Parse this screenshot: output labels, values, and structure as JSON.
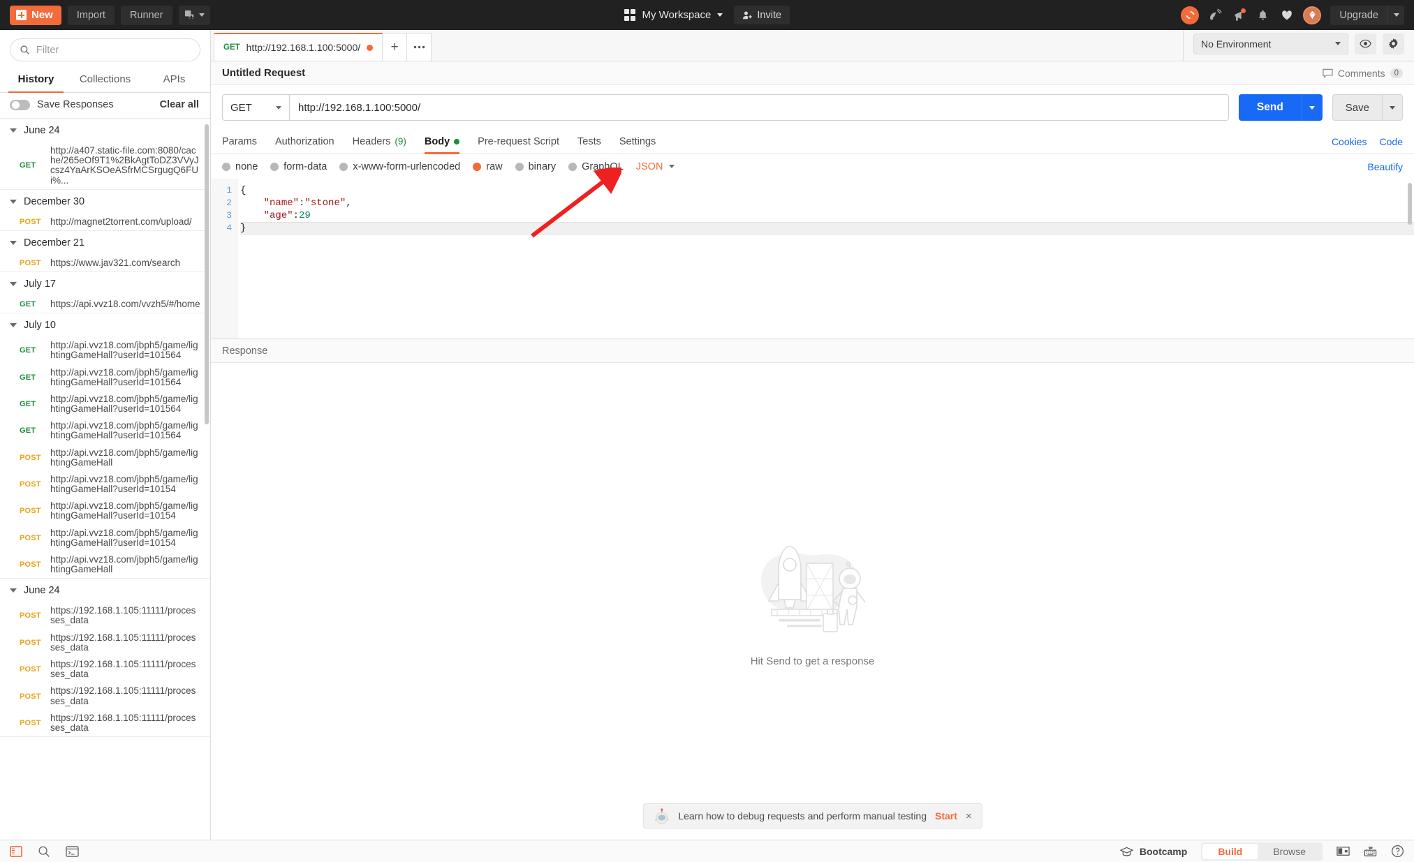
{
  "header": {
    "new_label": "New",
    "import_label": "Import",
    "runner_label": "Runner",
    "workspace_label": "My Workspace",
    "invite_label": "Invite",
    "upgrade_label": "Upgrade",
    "icons": [
      "sync-icon",
      "satellite-icon",
      "megaphone-icon",
      "bell-icon",
      "heart-icon",
      "avatar-icon"
    ],
    "accent_color": "#f26b3a",
    "bg_color": "#212121"
  },
  "sidebar": {
    "filter_placeholder": "Filter",
    "filter_value": "",
    "tabs": [
      {
        "label": "History",
        "active": true
      },
      {
        "label": "Collections",
        "active": false
      },
      {
        "label": "APIs",
        "active": false
      }
    ],
    "save_responses_label": "Save Responses",
    "save_responses_on": false,
    "clear_all_label": "Clear all",
    "groups": [
      {
        "date": "June 24",
        "items": [
          {
            "method": "GET",
            "url": "http://a407.static-file.com:8080/cache/265eOf9T1%2BkAgtToDZ3VVyJcsz4YaArKSOeASfrMCSrgugQ6FUi%..."
          }
        ]
      },
      {
        "date": "December 30",
        "items": [
          {
            "method": "POST",
            "url": "http://magnet2torrent.com/upload/"
          }
        ]
      },
      {
        "date": "December 21",
        "items": [
          {
            "method": "POST",
            "url": "https://www.jav321.com/search"
          }
        ]
      },
      {
        "date": "July 17",
        "items": [
          {
            "method": "GET",
            "url": "https://api.vvz18.com/vvzh5/#/home"
          }
        ]
      },
      {
        "date": "July 10",
        "items": [
          {
            "method": "GET",
            "url": "http://api.vvz18.com/jbph5/game/lightingGameHall?userId=101564"
          },
          {
            "method": "GET",
            "url": "http://api.vvz18.com/jbph5/game/lightingGameHall?userId=101564"
          },
          {
            "method": "GET",
            "url": "http://api.vvz18.com/jbph5/game/lightingGameHall?userId=101564"
          },
          {
            "method": "GET",
            "url": "http://api.vvz18.com/jbph5/game/lightingGameHall?userId=101564"
          },
          {
            "method": "POST",
            "url": "http://api.vvz18.com/jbph5/game/lightingGameHall"
          },
          {
            "method": "POST",
            "url": "http://api.vvz18.com/jbph5/game/lightingGameHall?userId=10154"
          },
          {
            "method": "POST",
            "url": "http://api.vvz18.com/jbph5/game/lightingGameHall?userId=10154"
          },
          {
            "method": "POST",
            "url": "http://api.vvz18.com/jbph5/game/lightingGameHall?userId=10154"
          },
          {
            "method": "POST",
            "url": "http://api.vvz18.com/jbph5/game/lightingGameHall"
          }
        ]
      },
      {
        "date": "June 24",
        "items": [
          {
            "method": "POST",
            "url": "https://192.168.1.105:11111/processes_data"
          },
          {
            "method": "POST",
            "url": "https://192.168.1.105:11111/processes_data"
          },
          {
            "method": "POST",
            "url": "https://192.168.1.105:11111/processes_data"
          },
          {
            "method": "POST",
            "url": "https://192.168.1.105:11111/processes_data"
          },
          {
            "method": "POST",
            "url": "https://192.168.1.105:11111/processes_data"
          }
        ]
      }
    ]
  },
  "tabstrip": {
    "tab_method": "GET",
    "tab_url": "http://192.168.1.100:5000/",
    "new_tab_label": "+",
    "more_label": "•••",
    "environment": "No Environment"
  },
  "request": {
    "title": "Untitled Request",
    "comments_label": "Comments",
    "comments_count": "0",
    "method": "GET",
    "url": "http://192.168.1.100:5000/",
    "send_label": "Send",
    "save_label": "Save",
    "tabs": [
      {
        "label": "Params",
        "active": false
      },
      {
        "label": "Authorization",
        "active": false
      },
      {
        "label": "Headers",
        "count": "(9)",
        "active": false
      },
      {
        "label": "Body",
        "dot": true,
        "active": true
      },
      {
        "label": "Pre-request Script",
        "active": false
      },
      {
        "label": "Tests",
        "active": false
      },
      {
        "label": "Settings",
        "active": false
      }
    ],
    "cookies_label": "Cookies",
    "code_label": "Code",
    "body_types": [
      {
        "label": "none",
        "selected": false
      },
      {
        "label": "form-data",
        "selected": false
      },
      {
        "label": "x-www-form-urlencoded",
        "selected": false
      },
      {
        "label": "raw",
        "selected": true
      },
      {
        "label": "binary",
        "selected": false
      },
      {
        "label": "GraphQL",
        "selected": false
      }
    ],
    "raw_format": "JSON",
    "beautify_label": "Beautify",
    "body_lines": [
      {
        "n": "1",
        "text": "{"
      },
      {
        "n": "2",
        "text": "    \"name\":\"stone\","
      },
      {
        "n": "3",
        "text": "    \"age\":29"
      },
      {
        "n": "4",
        "text": "}"
      }
    ],
    "body_value": "{\n    \"name\":\"stone\",\n    \"age\":29\n}"
  },
  "response": {
    "title": "Response",
    "empty_message": "Hit Send to get a response"
  },
  "toast": {
    "text": "Learn how to debug requests and perform manual testing",
    "start_label": "Start",
    "close_label": "×"
  },
  "statusbar": {
    "left_icons": [
      "sidebar-toggle-icon",
      "search-icon",
      "console-icon"
    ],
    "bootcamp_label": "Bootcamp",
    "modes": [
      {
        "label": "Build",
        "active": true
      },
      {
        "label": "Browse",
        "active": false
      }
    ],
    "right_icons": [
      "layout-icon",
      "keyboard-icon",
      "help-icon"
    ]
  }
}
